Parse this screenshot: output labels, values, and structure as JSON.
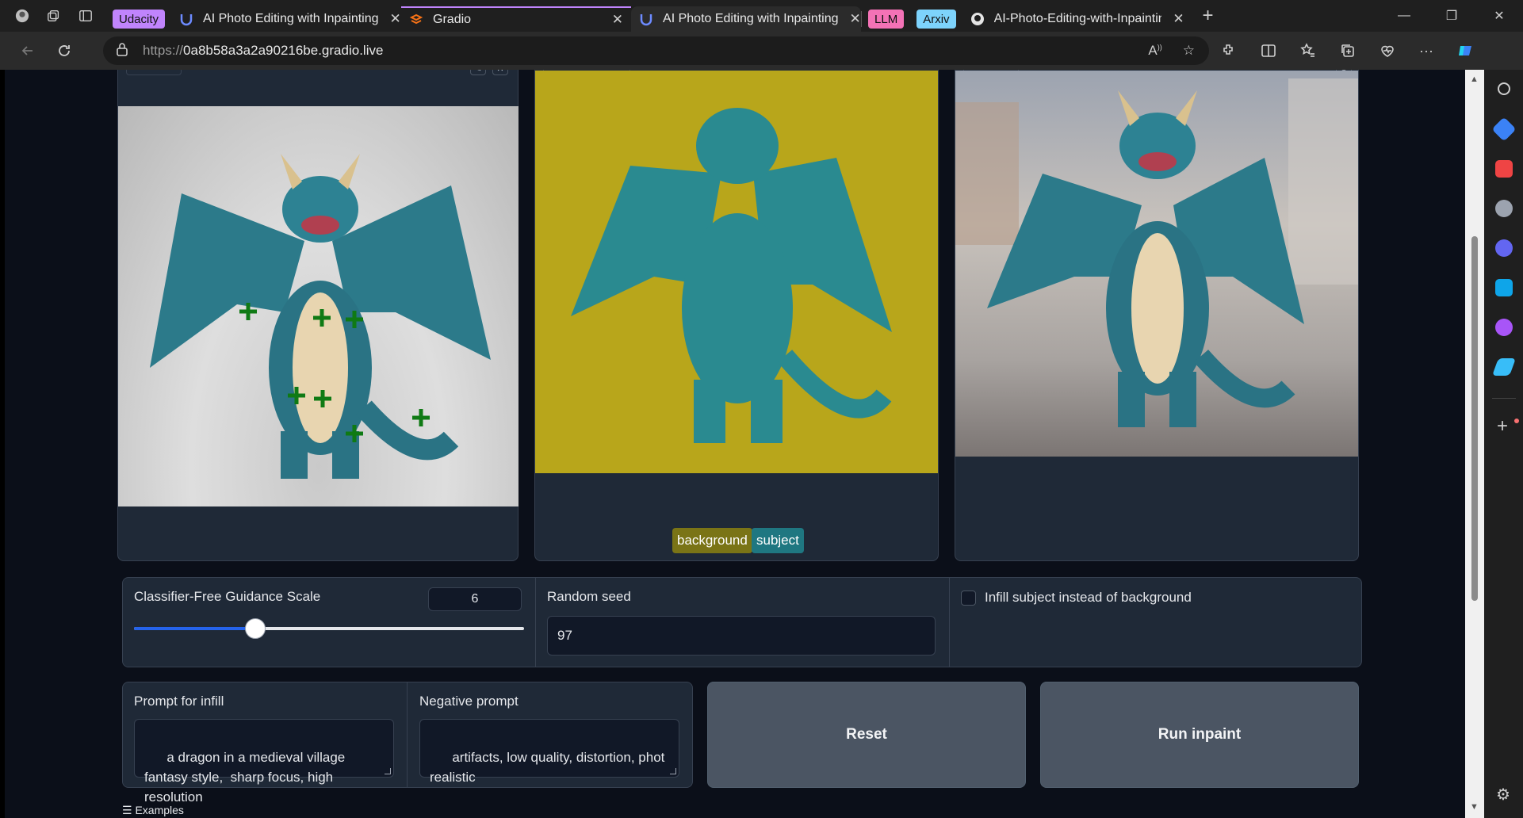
{
  "browser": {
    "tab_groups": [
      {
        "label": "Udacity",
        "color": "#c084fc"
      },
      {
        "label": "LLM",
        "color": "#f472b6"
      },
      {
        "label": "Arxiv",
        "color": "#7dd3fc"
      }
    ],
    "tabs": [
      {
        "title": "AI Photo Editing with Inpainting",
        "icon": "u-logo-icon"
      },
      {
        "title": "Gradio",
        "icon": "gradio-logo-icon"
      },
      {
        "title": "AI Photo Editing with Inpainting",
        "icon": "u-logo-icon"
      },
      {
        "title": "AI-Photo-Editing-with-Inpainting",
        "icon": "github-icon"
      }
    ],
    "url_protocol": "https://",
    "url_host": "0a8b58a3a2a90216be.gradio.live"
  },
  "mask_legend": {
    "background_label": "background",
    "subject_label": "subject",
    "background_color": "#7a7416",
    "subject_color": "#1f7781"
  },
  "controls": {
    "guidance_label": "Classifier-Free Guidance Scale",
    "guidance_value": "6",
    "guidance_fraction": 0.31,
    "seed_label": "Random seed",
    "seed_value": "97",
    "infill_checkbox_label": "Infill subject instead of background",
    "infill_checked": false
  },
  "prompts": {
    "infill_label": "Prompt for infill",
    "infill_value": "a dragon in a medieval village fantasy style,  sharp focus, high resolution",
    "negative_label": "Negative prompt",
    "negative_value": "artifacts, low quality, distortion, phot realistic"
  },
  "buttons": {
    "reset_label": "Reset",
    "run_label": "Run inpaint"
  },
  "examples_label": "Examples"
}
